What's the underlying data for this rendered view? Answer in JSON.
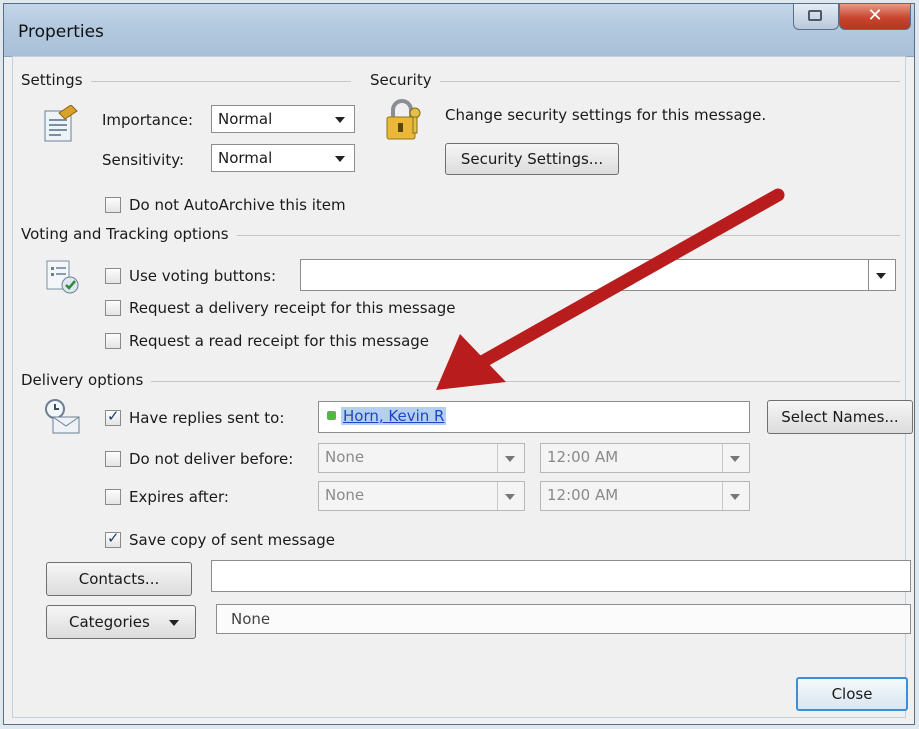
{
  "window": {
    "title": "Properties"
  },
  "settings": {
    "section_label": "Settings",
    "importance_label": "Importance:",
    "importance_value": "Normal",
    "sensitivity_label": "Sensitivity:",
    "sensitivity_value": "Normal",
    "autoarchive_label": "Do not AutoArchive this item",
    "autoarchive_checked": false
  },
  "security": {
    "section_label": "Security",
    "description": "Change security settings for this message.",
    "button_label": "Security Settings..."
  },
  "voting": {
    "section_label": "Voting and Tracking options",
    "voting_label": "Use voting buttons:",
    "voting_value": "",
    "delivery_receipt_label": "Request a delivery receipt for this message",
    "read_receipt_label": "Request a read receipt for this message"
  },
  "delivery": {
    "section_label": "Delivery options",
    "replies_label": "Have replies sent to:",
    "replies_checked": true,
    "replies_value": "Horn, Kevin R",
    "select_names_label": "Select Names...",
    "deliver_before_label": "Do not deliver before:",
    "deliver_before_date": "None",
    "deliver_before_time": "12:00 AM",
    "expires_label": "Expires after:",
    "expires_date": "None",
    "expires_time": "12:00 AM",
    "save_copy_label": "Save copy of sent message",
    "save_copy_checked": true
  },
  "contacts": {
    "button_label": "Contacts...",
    "value": ""
  },
  "categories": {
    "button_label": "Categories",
    "value": "None"
  },
  "footer": {
    "close_label": "Close"
  },
  "colors": {
    "arrow": "#b81c1c",
    "title_bar": "#b3c9df",
    "close_button": "#c9452e",
    "link": "#1a46c8"
  }
}
